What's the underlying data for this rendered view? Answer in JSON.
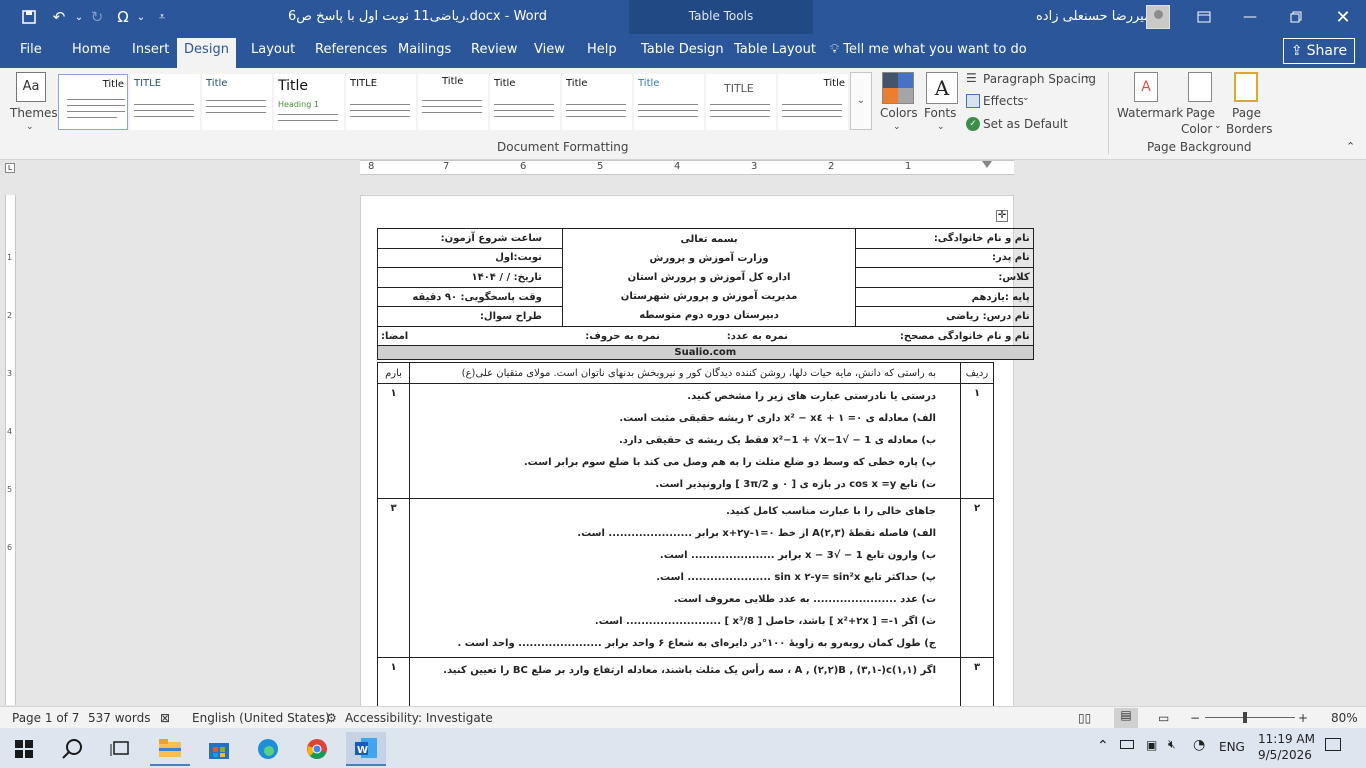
{
  "window": {
    "title": "رياضی11 نوبت اول با پاسخ ص6.docx  -  Word",
    "context_tab_group": "Table Tools",
    "user": "امیررضا حسنعلی زاده"
  },
  "menu": {
    "file": "File",
    "home": "Home",
    "insert": "Insert",
    "design": "Design",
    "layout": "Layout",
    "references": "References",
    "mailings": "Mailings",
    "review": "Review",
    "view": "View",
    "help": "Help",
    "table_design": "Table Design",
    "table_layout": "Table Layout",
    "tell_me": "Tell me what you want to do",
    "share": "Share"
  },
  "ribbon": {
    "themes": "Themes",
    "gallery_title": "Title",
    "gallery_heading": "Heading 1",
    "gallery_TITLE": "TITLE",
    "colors": "Colors",
    "fonts": "Fonts",
    "paragraph_spacing": "Paragraph Spacing",
    "effects": "Effects",
    "set_as_default": "Set as Default",
    "document_formatting": "Document Formatting",
    "watermark": "Watermark",
    "page_color_1": "Page",
    "page_color_2": "Color",
    "page_borders_1": "Page",
    "page_borders_2": "Borders",
    "page_background": "Page Background"
  },
  "doc": {
    "h_name": "نام و نام خانوادگی:",
    "h_father": "نام پدر:",
    "h_class": "کلاس:",
    "h_grade": "پایه :یازدهم",
    "h_course": "نام درس: ریاضی",
    "c1": "بسمه تعالی",
    "c2": "وزارت آموزش و پرورش",
    "c3": "اداره کل آموزش و پرورش استان",
    "c4": "مدیریت آموزش و پرورش شهرستان",
    "c5": "دبیرستان دوره دوم متوسطه",
    "l1": "ساعت شروع آزمون:",
    "l2": "نوبت:اول",
    "l3": "تاریخ:   /    /    ۱۴۰۴",
    "l4": "وقت پاسخگویی: ۹۰ دقیقه",
    "l5": "طراح سوال:",
    "corrector": "نام و نام خانوادگی مصحح:",
    "score_num": "نمره به عدد:",
    "score_word": "نمره به حروف:",
    "sign": "امضا:",
    "site": "Sualio.com",
    "col_row": "ردیف",
    "col_mark": "بارم",
    "motto": "به راستی که دانش، مایه حیات دلها، روشن کننده دیدگان کور و نیروبخش بدنهای ناتوان است. مولای متقیان علی(ع)",
    "q1_num": "۱",
    "q1_mark": "۱",
    "q1_title": "درستی یا نادرستی عبارت های زیر را مشخص کنید.",
    "q1_a": "الف) معادله ی  ۰= ۱ + x٤ − x²  داری ۲ ریشه حقیقی مثبت است.",
    "q1_b": "ب) معادله ی  1 − √x²−1 + √x−1  فقط یک ریشه ی حقیقی دارد.",
    "q1_p": "پ) پاره خطی که وسط دو ضلع مثلث را به هم وصل می کند با ضلع سوم برابر است.",
    "q1_t": "ت) تابع cos x  =y  در بازه ی [ ۰ و 3π/2 ]  وارونپذیر است.",
    "q2_num": "۲",
    "q2_mark": "۳",
    "q2_title": "جاهای خالی را با عبارت مناسب کامل کنید.",
    "q2_a": "الف) فاصله نقطۀ   (۲,۳)A  از خط   ۰=۱-x+۲y برابر ...................... است.",
    "q2_b": "ب) وارون تابع 1 − √x − 3 برابر ...................... است.",
    "q2_p": "پ) حداکثر تابع   sin x ۲-y= sin²x ...................... است.",
    "q2_t": "ت)  عدد ...................... به عدد طلایی معروف است.",
    "q2_s": "ث) اگر  ۱-= [ x²+۲x ] باشد، حاصل [ x³/8 ] ......................... است.",
    "q2_c": "ج) طول کمان روبه‌رو به زاویۀ  ۱۰۰°در دایره‌ای به شعاع ۶ واحد برابر ...................... واحد است .",
    "q3_num": "۳",
    "q3_mark": "۱",
    "q3_text": "اگر    (۱,۱)A  ,  (۲,۲)B  ,  (۳,۱-)c ، سه رأس یک مثلث باشند، معادله ارتفاع وارد بر ضلع BC را تعیین کنید."
  },
  "ruler": {
    "h": [
      "8",
      "7",
      "6",
      "5",
      "4",
      "3",
      "2",
      "1"
    ]
  },
  "status": {
    "page": "Page 1 of 7",
    "words": "537 words",
    "language": "English (United States)",
    "accessibility": "Accessibility: Investigate",
    "zoom": "80%"
  },
  "taskbar": {
    "lang": "ENG",
    "time": "11:19 AM",
    "date": "9/5/2026"
  }
}
